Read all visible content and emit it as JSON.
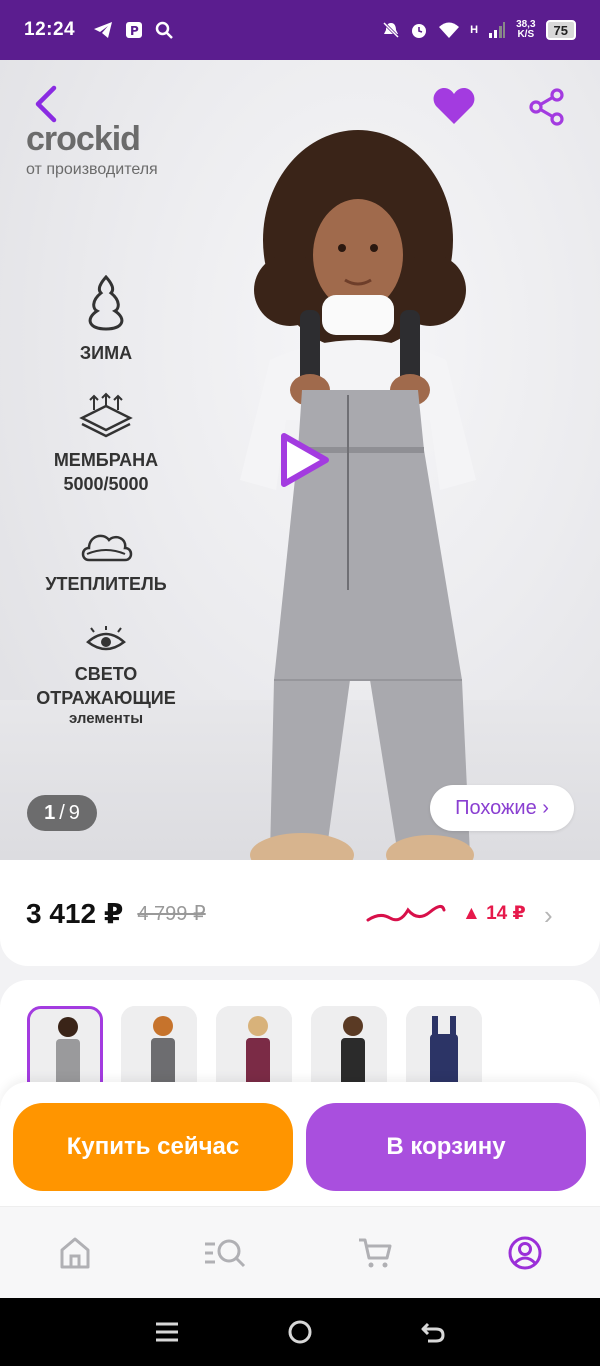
{
  "status_bar": {
    "time": "12:24",
    "network_label": "H",
    "speed_value": "38,3",
    "speed_unit": "K/S",
    "battery": "75",
    "icons": [
      "telegram-icon",
      "parking-app-icon",
      "search-icon",
      "mute-icon",
      "alarm-icon",
      "wifi-icon",
      "signal-icon",
      "battery-icon"
    ]
  },
  "header": {
    "back_icon": "back-arrow-icon",
    "favorite_icon": "heart-icon",
    "share_icon": "share-icon"
  },
  "brand": {
    "logo_text": "crockid",
    "subtitle": "от производителя"
  },
  "features": [
    {
      "label": "ЗИМА",
      "icon": "snow-tree-icon"
    },
    {
      "label": "МЕМБРАНА\n5000/5000",
      "icon": "membrane-icon"
    },
    {
      "label": "УТЕПЛИТЕЛЬ",
      "icon": "cloud-insulation-icon"
    },
    {
      "label": "СВЕТО\nОТРАЖАЮЩИЕ",
      "small": "элементы",
      "icon": "eye-icon"
    }
  ],
  "gallery": {
    "current": "1",
    "separator": "/",
    "total": "9",
    "similar_label": "Похожие ›"
  },
  "price": {
    "current": "3 412 ₽",
    "old": "4 799 ₽",
    "trend": "▲ 14 ₽",
    "trend_color": "#e6194b"
  },
  "variants": [
    {
      "color": "#9a9a9c",
      "selected": true
    },
    {
      "color": "#6d6d70",
      "selected": false
    },
    {
      "color": "#7b2b46",
      "selected": false
    },
    {
      "color": "#2b2b2b",
      "selected": false
    },
    {
      "color": "#2c3466",
      "selected": false
    }
  ],
  "actions": {
    "buy_now": "Купить сейчас",
    "add_to_cart": "В корзину"
  },
  "colors": {
    "accent": "#a94fde",
    "orange": "#ff9500",
    "status_bar": "#5b1d8f"
  },
  "bottom_nav": [
    "home-icon",
    "catalog-search-icon",
    "cart-icon",
    "profile-icon"
  ],
  "system_nav": [
    "recent-apps-icon",
    "home-circle-icon",
    "back-icon"
  ]
}
